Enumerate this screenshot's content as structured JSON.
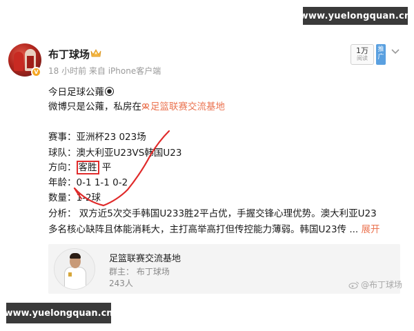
{
  "watermarks": {
    "top": "www.yuelongquan.cn",
    "bottom": "www.yuelongquan.cn"
  },
  "post": {
    "username": "布丁球场",
    "meta": "18 小时前  来自 iPhone客户端",
    "follow_count": "1万",
    "follow_label": "阅读",
    "promote_label": "推广",
    "body": {
      "line1": "今日足球公蕹",
      "line2_prefix": "微博只是公蕹，私房在",
      "line2_link": "足篮联赛交流基地",
      "match_label": "赛事：",
      "match_value": "亚洲杯23 023场",
      "teams_label": "球队：",
      "teams_value": "澳大利亚U23VS韩国U23",
      "direction_label": "方向：",
      "direction_boxed": "客胜",
      "direction_rest": "  平",
      "age_label": "年龄：",
      "age_value": "0-1 1-1 0-2",
      "count_label": "数量：",
      "count_value": "1-2球",
      "analysis_line1": "分析：  双方近5次交手韩国U233胜2平占优，手握交锋心理优势。澳大利亚U23",
      "analysis_line2": "多名核心缺阵且体能消耗大，主打高举高打但传控能力薄弱。韩国U23传  ...",
      "expand_label": "展开"
    },
    "group_card": {
      "name": "足篮联赛交流基地",
      "owner": "群主：  布丁球场",
      "members": "243人"
    },
    "weibo_watermark": "@布丁球场"
  },
  "colors": {
    "link": "#eb7350",
    "annotation_red": "#e02a2a",
    "watermark_bg": "#3a3a3a"
  }
}
